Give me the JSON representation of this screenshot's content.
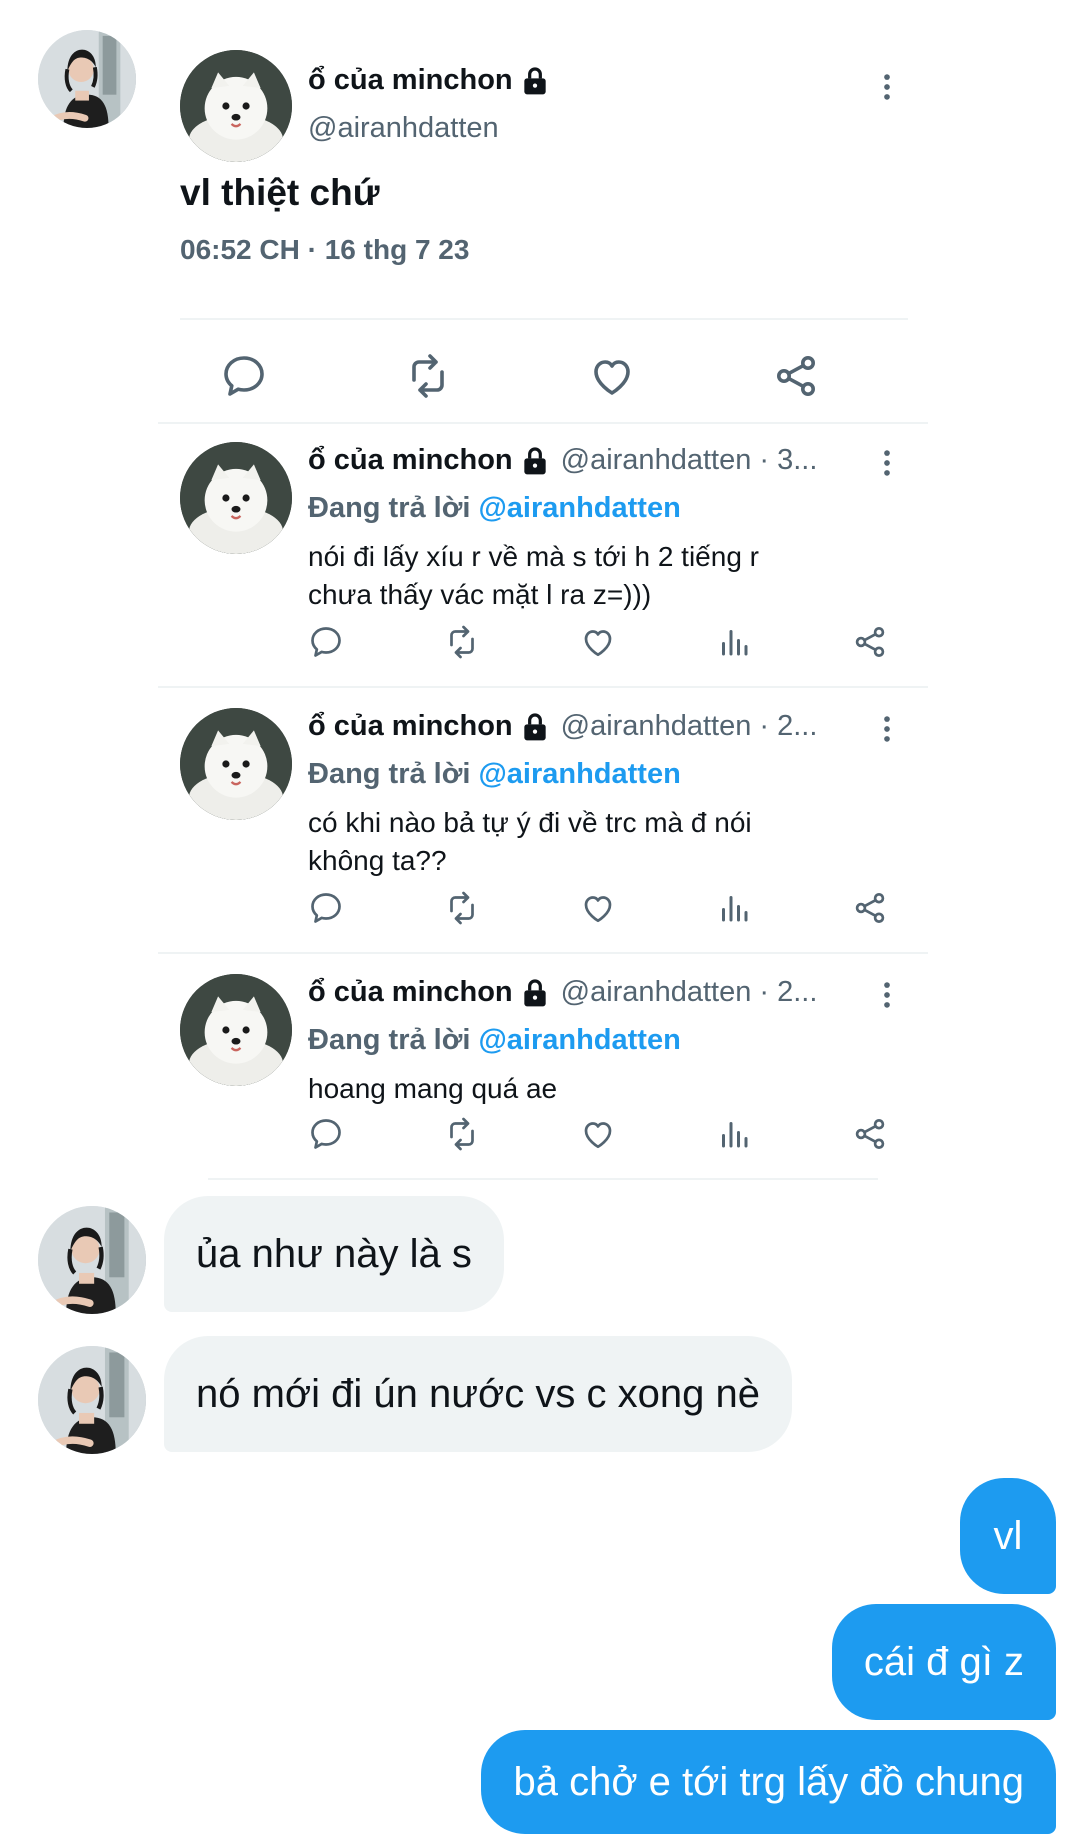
{
  "tweet": {
    "display_name": "ổ của minchon",
    "handle": "@airanhdatten",
    "text": "vl thiệt chứ",
    "timestamp": "06:52 CH · 16 thg 7 23"
  },
  "replies": [
    {
      "display_name": "ổ của minchon",
      "handle_time": "@airanhdatten · 3...",
      "replying_prefix": "Đang trả lời ",
      "replying_to": "@airanhdatten",
      "text": "nói đi lấy xíu r về mà s tới h 2 tiếng r chưa thấy vác mặt l ra z=)))"
    },
    {
      "display_name": "ổ của minchon",
      "handle_time": "@airanhdatten · 2...",
      "replying_prefix": "Đang trả lời ",
      "replying_to": "@airanhdatten",
      "text": "có khi nào bả tự ý đi về trc mà đ nói không ta??"
    },
    {
      "display_name": "ổ của minchon",
      "handle_time": "@airanhdatten · 2...",
      "replying_prefix": "Đang trả lời ",
      "replying_to": "@airanhdatten",
      "text": "hoang mang quá ae"
    }
  ],
  "messages": {
    "incoming": [
      "ủa như này là s",
      "nó mới đi ún nước vs c xong nè"
    ],
    "outgoing": [
      "vl",
      "cái đ gì z",
      "bả chở e tới trg lấy đồ chung"
    ]
  },
  "colors": {
    "accent": "#1d9bf0",
    "bubble_in": "#eff3f4",
    "text": "#0f1419",
    "secondary": "#536471"
  },
  "icons": [
    "more-icon",
    "lock-icon",
    "reply-icon",
    "retweet-icon",
    "like-icon",
    "share-icon",
    "analytics-icon"
  ]
}
